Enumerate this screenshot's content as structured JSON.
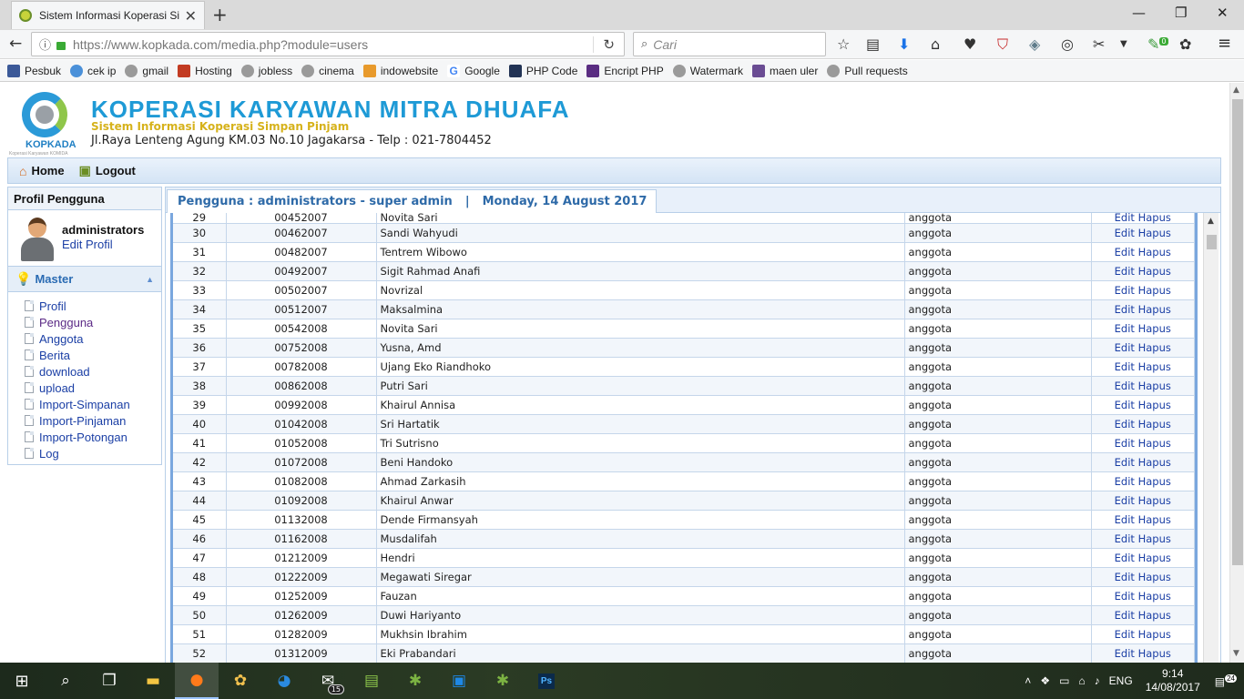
{
  "browser": {
    "tab_title": "Sistem Informasi Koperasi Si",
    "url": "https://www.kopkada.com/media.php?module=users",
    "search_placeholder": "Cari",
    "bookmarks": [
      {
        "label": "Pesbuk",
        "color": "#3b5998"
      },
      {
        "label": "cek ip",
        "color": "#4a90d9"
      },
      {
        "label": "gmail",
        "color": "#9a9a9a"
      },
      {
        "label": "Hosting",
        "color": "#c23b22"
      },
      {
        "label": "jobless",
        "color": "#9a9a9a"
      },
      {
        "label": "cinema",
        "color": "#9a9a9a"
      },
      {
        "label": "indowebsite",
        "color": "#e89a2c"
      },
      {
        "label": "Google",
        "color": "#4285f4"
      },
      {
        "label": "PHP Code",
        "color": "#223355"
      },
      {
        "label": "Encript PHP",
        "color": "#5a2d82"
      },
      {
        "label": "Watermark",
        "color": "#9a9a9a"
      },
      {
        "label": "maen uler",
        "color": "#6a4c93"
      },
      {
        "label": "Pull requests",
        "color": "#9a9a9a"
      }
    ],
    "addon_badge": "0"
  },
  "site": {
    "logo_text": "KOPKADA",
    "logo_sub": "Koperasi Karyawan KOMIDA",
    "title": "KOPERASI KARYAWAN MITRA DHUAFA",
    "subtitle": "Sistem Informasi Koperasi Simpan Pinjam",
    "address": "Jl.Raya Lenteng Agung KM.03 No.10 Jagakarsa - Telp : 021-7804452"
  },
  "menu": {
    "home": "Home",
    "logout": "Logout"
  },
  "sidebar": {
    "profile_header": "Profil Pengguna",
    "username": "administrators",
    "edit_profile": "Edit Profil",
    "section_title": "Master",
    "items": [
      {
        "label": "Profil"
      },
      {
        "label": "Pengguna"
      },
      {
        "label": "Anggota"
      },
      {
        "label": "Berita"
      },
      {
        "label": "download"
      },
      {
        "label": "upload"
      },
      {
        "label": "Import-Simpanan"
      },
      {
        "label": "Import-Pinjaman"
      },
      {
        "label": "Import-Potongan"
      },
      {
        "label": "Log"
      }
    ]
  },
  "main": {
    "user_info": "Pengguna : administrators - super admin",
    "separator": "|",
    "date": "Monday, 14 August 2017",
    "edit_label": "Edit",
    "delete_label": "Hapus",
    "rows": [
      {
        "no": "29",
        "id": "00452007",
        "name": "Novita Sari",
        "level": "anggota"
      },
      {
        "no": "30",
        "id": "00462007",
        "name": "Sandi Wahyudi",
        "level": "anggota"
      },
      {
        "no": "31",
        "id": "00482007",
        "name": "Tentrem Wibowo",
        "level": "anggota"
      },
      {
        "no": "32",
        "id": "00492007",
        "name": "Sigit Rahmad Anafi",
        "level": "anggota"
      },
      {
        "no": "33",
        "id": "00502007",
        "name": "Novrizal",
        "level": "anggota"
      },
      {
        "no": "34",
        "id": "00512007",
        "name": "Maksalmina",
        "level": "anggota"
      },
      {
        "no": "35",
        "id": "00542008",
        "name": "Novita Sari",
        "level": "anggota"
      },
      {
        "no": "36",
        "id": "00752008",
        "name": "Yusna, Amd",
        "level": "anggota"
      },
      {
        "no": "37",
        "id": "00782008",
        "name": "Ujang Eko Riandhoko",
        "level": "anggota"
      },
      {
        "no": "38",
        "id": "00862008",
        "name": "Putri Sari",
        "level": "anggota"
      },
      {
        "no": "39",
        "id": "00992008",
        "name": "Khairul Annisa",
        "level": "anggota"
      },
      {
        "no": "40",
        "id": "01042008",
        "name": "Sri Hartatik",
        "level": "anggota"
      },
      {
        "no": "41",
        "id": "01052008",
        "name": "Tri Sutrisno",
        "level": "anggota"
      },
      {
        "no": "42",
        "id": "01072008",
        "name": "Beni Handoko",
        "level": "anggota"
      },
      {
        "no": "43",
        "id": "01082008",
        "name": "Ahmad Zarkasih",
        "level": "anggota"
      },
      {
        "no": "44",
        "id": "01092008",
        "name": "Khairul Anwar",
        "level": "anggota"
      },
      {
        "no": "45",
        "id": "01132008",
        "name": "Dende Firmansyah",
        "level": "anggota"
      },
      {
        "no": "46",
        "id": "01162008",
        "name": "Musdalifah",
        "level": "anggota"
      },
      {
        "no": "47",
        "id": "01212009",
        "name": "Hendri",
        "level": "anggota"
      },
      {
        "no": "48",
        "id": "01222009",
        "name": "Megawati Siregar",
        "level": "anggota"
      },
      {
        "no": "49",
        "id": "01252009",
        "name": "Fauzan",
        "level": "anggota"
      },
      {
        "no": "50",
        "id": "01262009",
        "name": "Duwi Hariyanto",
        "level": "anggota"
      },
      {
        "no": "51",
        "id": "01282009",
        "name": "Mukhsin Ibrahim",
        "level": "anggota"
      },
      {
        "no": "52",
        "id": "01312009",
        "name": "Eki Prabandari",
        "level": "anggota"
      }
    ]
  },
  "taskbar": {
    "mail_badge": "15",
    "language": "ENG",
    "time": "9:14",
    "date": "14/08/2017",
    "notifications": "24"
  }
}
